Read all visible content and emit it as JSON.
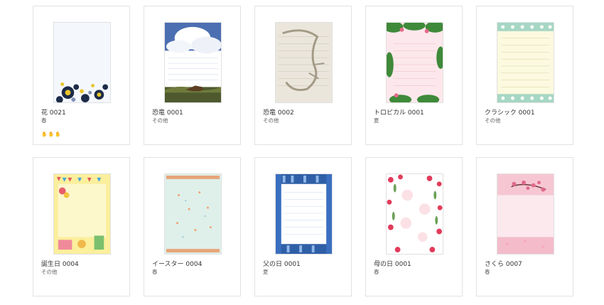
{
  "cards": [
    {
      "title": "花 0021",
      "season": "春"
    },
    {
      "title": "恐竜 0001",
      "season": "その他"
    },
    {
      "title": "恐竜 0002",
      "season": "その他"
    },
    {
      "title": "トロピカル 0001",
      "season": "夏"
    },
    {
      "title": "クラシック 0001",
      "season": "その他"
    },
    {
      "title": "誕生日 0004",
      "season": "その他"
    },
    {
      "title": "イースター 0004",
      "season": "春"
    },
    {
      "title": "父の日 0001",
      "season": "夏"
    },
    {
      "title": "母の日 0001",
      "season": "春"
    },
    {
      "title": "さくら 0007",
      "season": "春"
    }
  ],
  "card0_extra_icons": "✋✋✋",
  "colors": {
    "card_border": "#e2e2e2",
    "title_text": "#333333",
    "season_text": "#666666"
  }
}
